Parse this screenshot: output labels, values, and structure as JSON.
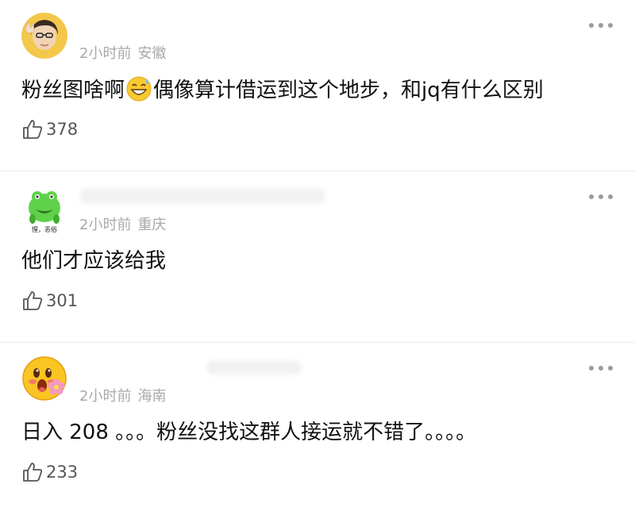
{
  "comments": [
    {
      "avatar": "person-photo-avatar",
      "time": "2小时前",
      "location": "安徽",
      "text_before_emoji": "粉丝图啥啊",
      "emoji": "sweat-smile-emoji",
      "text_after_emoji": "偶像算计借运到这个地步，和jq有什么区别",
      "likes": "378"
    },
    {
      "avatar": "green-frog-avatar",
      "avatar_caption": "惺，恶俗",
      "time": "2小时前",
      "location": "重庆",
      "text": "他们才应该给我",
      "likes": "301"
    },
    {
      "avatar": "blushing-emoji-flower-avatar",
      "time": "2小时前",
      "location": "海南",
      "text": "日入 208 。。。粉丝没找这群人接运就不错了。。。。",
      "likes": "233"
    }
  ],
  "icons": {
    "like": "thumbs-up-icon",
    "more": "more-dots-icon"
  },
  "colors": {
    "meta": "#a9a9a9",
    "text": "#111111",
    "divider": "#ececec"
  }
}
